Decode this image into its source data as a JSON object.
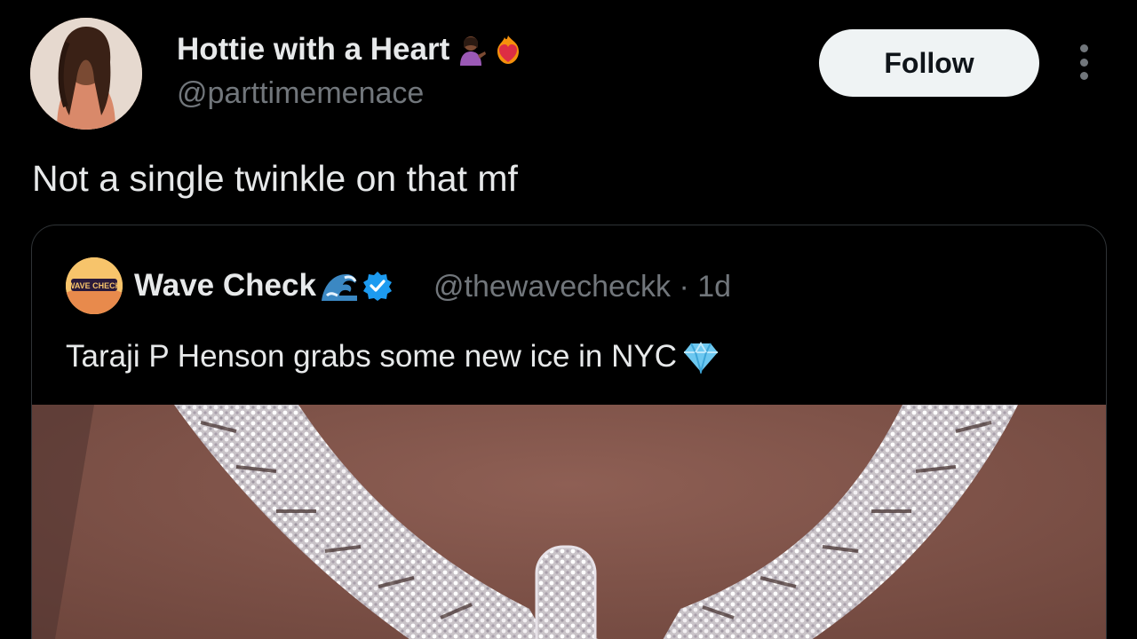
{
  "author": {
    "name": "Hottie with a Heart",
    "handle": "@parttimemenace",
    "name_emojis": [
      "person-tipping-hand-emoji",
      "heart-on-fire-emoji"
    ]
  },
  "actions": {
    "follow_label": "Follow"
  },
  "tweet": {
    "text": "Not a single twinkle on that mf"
  },
  "quoted": {
    "avatar_label": "WAVE CHECK",
    "name": "Wave Check",
    "name_emoji": "water-wave-emoji",
    "verified": true,
    "handle": "@thewavecheckk",
    "age": "1d",
    "text": "Taraji P Henson grabs some new ice in NYC",
    "text_emoji": "gem-stone-emoji",
    "media": "necklace-photo"
  },
  "colors": {
    "background": "#000000",
    "text_primary": "#e7e9ea",
    "text_secondary": "#71767b",
    "follow_bg": "#eff3f4",
    "verified_blue": "#1d9bf0",
    "border": "#2f3336"
  }
}
